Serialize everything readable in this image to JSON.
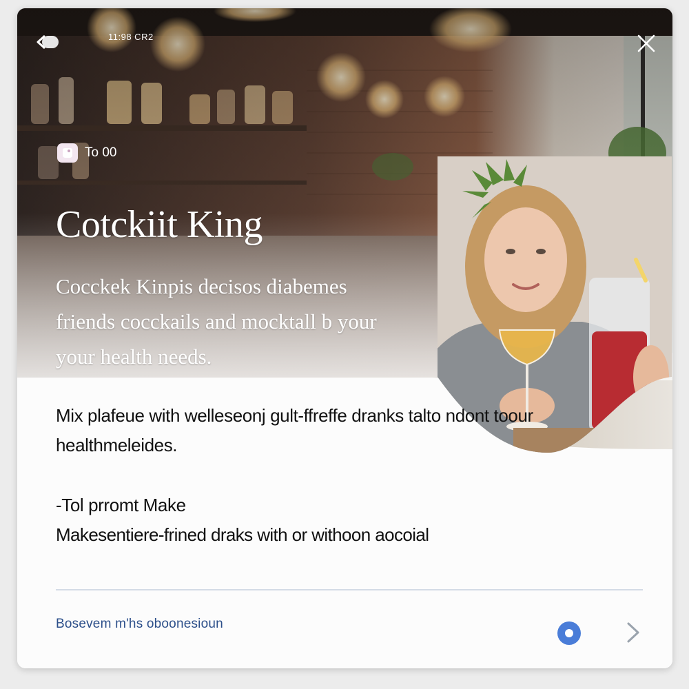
{
  "status": {
    "time": "11:98 CR2"
  },
  "badge": {
    "label": "To 00",
    "icon": "tag-icon"
  },
  "hero": {
    "title": "Cotckiit King",
    "subtitle": "Cocckek Kinpis decisos diabemes friends cocckails and mocktall b your your health needs."
  },
  "content": {
    "description": "Mix plafeue with welleseonj gult-ffreffe dranks talto ndont toour healthmeleides.",
    "prompt_heading": "-Tol prromt Make",
    "prompt_body": "Makesentiere-frined draks with or withoon aocoial"
  },
  "footer": {
    "link": "Bosevem m'hs oboonesioun",
    "radio_icon": "radio-selected-icon",
    "next_icon": "chevron-right-icon"
  },
  "colors": {
    "accent": "#4a7dd8",
    "link": "#2c4f8a",
    "divider": "#d4dbe6",
    "text": "#111111"
  }
}
